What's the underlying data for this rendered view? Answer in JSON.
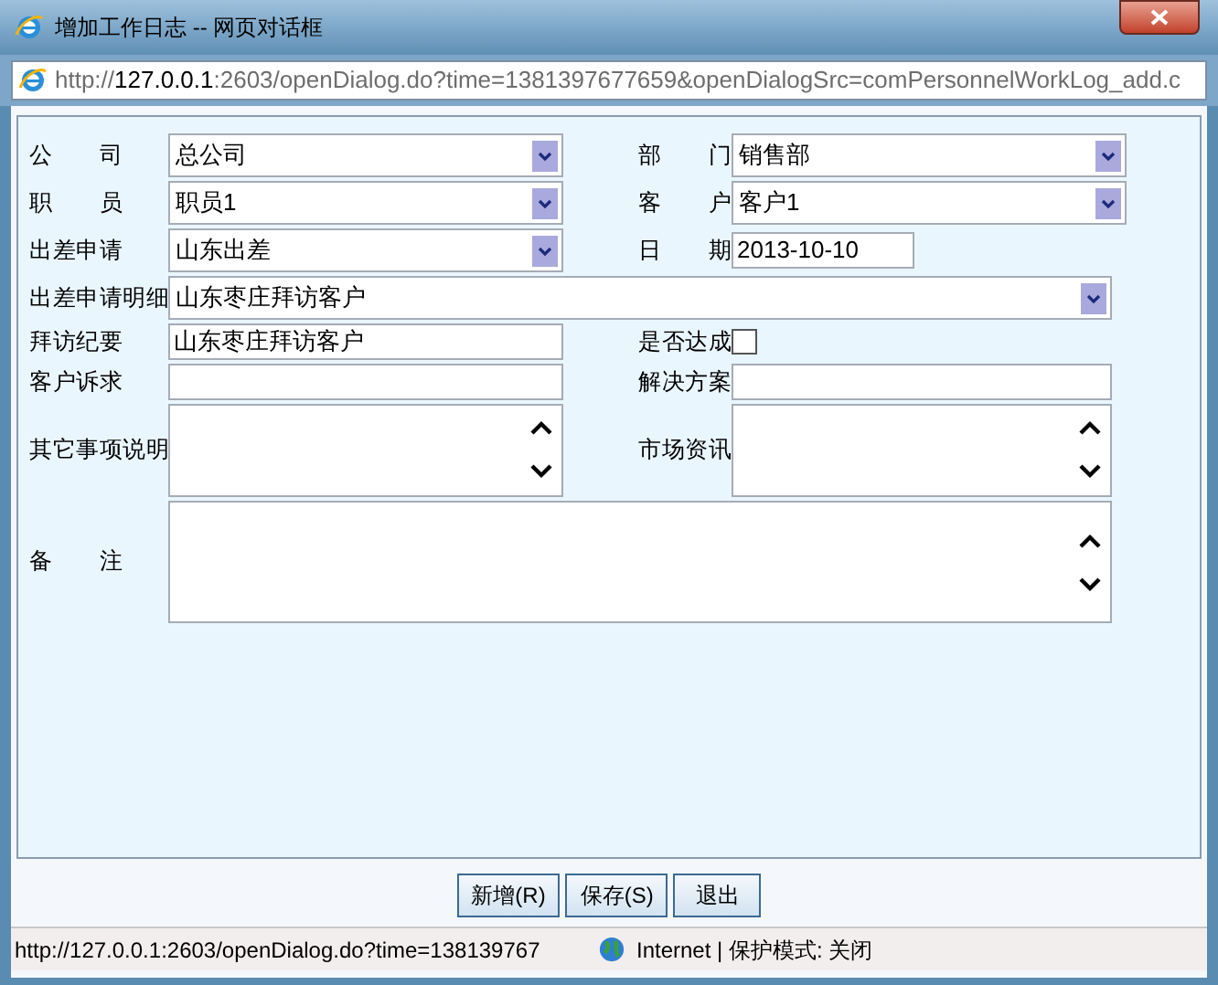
{
  "window": {
    "title": "增加工作日志 -- 网页对话框"
  },
  "address": {
    "scheme": "http://",
    "host": "127.0.0.1",
    "rest": ":2603/openDialog.do?time=1381397677659&openDialogSrc=comPersonnelWorkLog_add.c"
  },
  "form": {
    "rows": [
      {
        "items": [
          {
            "label": "公　　司",
            "kind": "select",
            "value": "总公司"
          },
          {
            "label": "部　　门",
            "kind": "select",
            "value": "销售部"
          }
        ]
      },
      {
        "items": [
          {
            "label": "职　　员",
            "kind": "select",
            "value": "职员1"
          },
          {
            "label": "客　　户",
            "kind": "select",
            "value": "客户1"
          }
        ]
      },
      {
        "items": [
          {
            "label": "出差申请",
            "kind": "select",
            "value": "山东出差"
          },
          {
            "label": "日　　期",
            "kind": "date",
            "value": "2013-10-10"
          }
        ]
      },
      {
        "items": [
          {
            "label": "出差申请明细",
            "kind": "select",
            "value": "山东枣庄拜访客户"
          }
        ]
      },
      {
        "items": [
          {
            "label": "拜访纪要",
            "kind": "input",
            "value": "山东枣庄拜访客户"
          },
          {
            "label": "是否达成",
            "kind": "checkbox",
            "checked": false
          }
        ]
      },
      {
        "items": [
          {
            "label": "客户诉求",
            "kind": "input"
          },
          {
            "label": "解决方案",
            "kind": "input"
          }
        ]
      },
      {
        "items": [
          {
            "label": "其它事项说明",
            "kind": "textarea"
          },
          {
            "label": "市场资讯",
            "kind": "textarea"
          }
        ]
      },
      {
        "items": [
          {
            "label": "备　　注",
            "kind": "textarea"
          }
        ]
      }
    ]
  },
  "buttons": [
    "新增(R)",
    "保存(S)",
    "退出"
  ],
  "status_bar": {
    "url": "http://127.0.0.1:2603/openDialog.do?time=138139767",
    "zone": "Internet | 保护模式: 关闭"
  }
}
